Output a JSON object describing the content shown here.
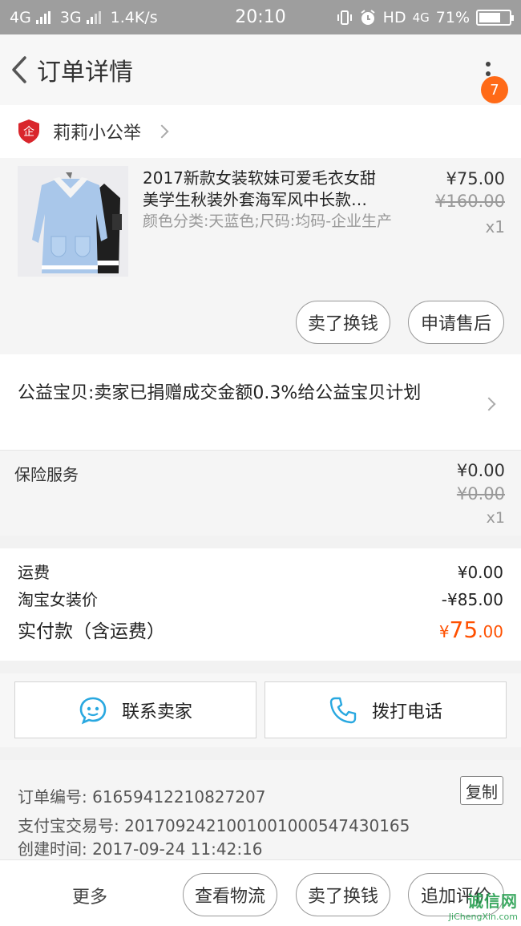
{
  "status_bar": {
    "net1": "4G",
    "net2": "3G",
    "speed": "1.4K/s",
    "time": "20:10",
    "hd": "HD",
    "net3": "4G",
    "battery": "71%",
    "battery_level": 0.71
  },
  "header": {
    "title": "订单详情",
    "badge_count": "7"
  },
  "shop": {
    "name": "莉莉小公举",
    "logo_text": "企"
  },
  "item": {
    "name_line1": "2017新款女装软妹可爱毛衣女甜",
    "name_line2": "美学生秋装外套海军风中长款…",
    "spec": "颜色分类:天蓝色;尺码:均码-企业生产",
    "price": "¥75.00",
    "original_price": "¥160.00",
    "quantity": "x1",
    "sell_button": "卖了换钱",
    "aftersale_button": "申请售后"
  },
  "charity": {
    "text": "公益宝贝:卖家已捐赠成交金额0.3%给公益宝贝计划"
  },
  "insurance": {
    "label": "保险服务",
    "price": "¥0.00",
    "original_price": "¥0.00",
    "quantity": "x1"
  },
  "summary": {
    "shipping_label": "运费",
    "shipping_value": "¥0.00",
    "discount_label": "淘宝女装价",
    "discount_value": "-¥85.00",
    "total_label": "实付款（含运费）",
    "total_currency": "¥",
    "total_int": "75",
    "total_dec": ".00"
  },
  "contact": {
    "seller_label": "联系卖家",
    "phone_label": "拨打电话"
  },
  "order_info": {
    "order_no": "订单编号: 61659412210827207",
    "alipay_no": "支付宝交易号: 2017092421001001000547430165",
    "created": "创建时间: 2017-09-24 11:42:16",
    "copy_label": "复制"
  },
  "bottom_bar": {
    "more": "更多",
    "logistics": "查看物流",
    "sell": "卖了换钱",
    "review": "追加评价"
  },
  "watermark": {
    "line1": "诚信网",
    "line2": "JiChengXin.com"
  },
  "colors": {
    "accent": "#ff5000",
    "badge": "#ff6a17",
    "status_bar": "#9e9e9e",
    "shop_logo": "#d9262c",
    "contact_icon": "#29a8e0"
  }
}
